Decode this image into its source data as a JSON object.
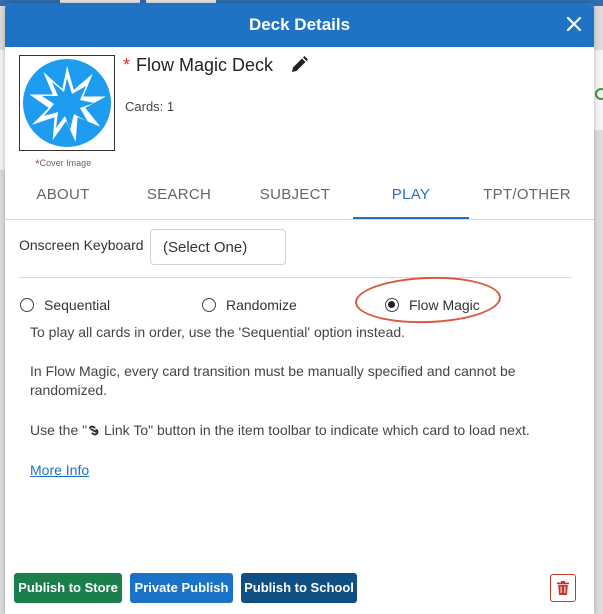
{
  "modal": {
    "title": "Deck Details",
    "close_icon": "close-icon"
  },
  "deck": {
    "required_mark": "*",
    "name": "Flow Magic Deck",
    "cards_label": "Cards: 1",
    "cover_label": "Cover Image",
    "cover_icon": "starburst-icon",
    "cover_color": "#1e9cf0",
    "edit_icon": "pencil-icon"
  },
  "tabs": [
    {
      "label": "ABOUT",
      "active": false
    },
    {
      "label": "SEARCH",
      "active": false
    },
    {
      "label": "SUBJECT",
      "active": false
    },
    {
      "label": "PLAY",
      "active": true
    },
    {
      "label": "TPT/OTHER",
      "active": false
    }
  ],
  "play": {
    "keyboard_label": "Onscreen Keyboard",
    "keyboard_value": "(Select One)",
    "order_options": [
      {
        "label": "Sequential",
        "checked": false
      },
      {
        "label": "Randomize",
        "checked": false
      },
      {
        "label": "Flow Magic",
        "checked": true
      }
    ],
    "info_line1": "To play all cards in order, use the 'Sequential' option instead.",
    "info_line2": "In Flow Magic, every card transition must be manually specified and cannot be randomized.",
    "info_line3_before": "Use the \"",
    "info_line3_link": " Link To",
    "info_line3_after": "\" button in the item toolbar to indicate which card to load next.",
    "more_info": "More Info"
  },
  "footer": {
    "publish_store": "Publish to Store",
    "private_publish": "Private Publish",
    "publish_school": "Publish to School",
    "delete_icon": "trash-icon"
  },
  "colors": {
    "header": "#1f72c4",
    "accent": "#1f72c4",
    "store_button": "#1b7f4b",
    "private_button": "#1a73c9",
    "school_button": "#0f4f84",
    "delete": "#c0392b",
    "highlight_ring": "#d9583c"
  }
}
